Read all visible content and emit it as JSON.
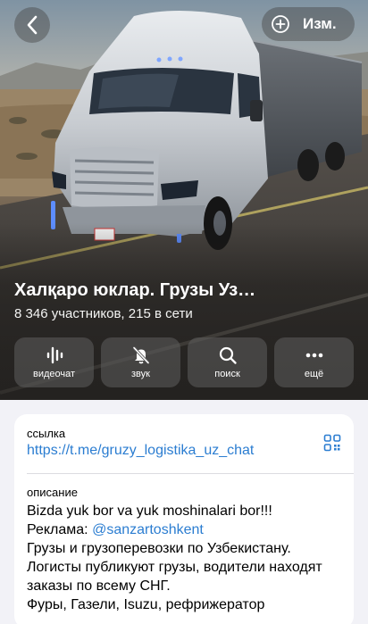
{
  "header": {
    "back_icon": "chevron-left-icon",
    "edit_icon": "add-circle-icon",
    "edit_label": "Изм."
  },
  "chat": {
    "title": "Халқаро юклар. Грузы Уз…",
    "subtitle": "8 346 участников, 215 в сети"
  },
  "actions": [
    {
      "icon": "voice-chat-icon",
      "label": "видеочат"
    },
    {
      "icon": "bell-muted-icon",
      "label": "звук"
    },
    {
      "icon": "search-icon",
      "label": "поиск"
    },
    {
      "icon": "more-icon",
      "label": "ещё"
    }
  ],
  "info": {
    "link_caption": "ссылка",
    "link_value": "https://t.me/gruzy_logistika_uz_chat",
    "qr_icon": "qr-code-icon",
    "description_caption": "описание",
    "description": {
      "line1": "Bizda yuk bor va yuk moshinalari bor!!!",
      "line2_prefix": "Реклама: ",
      "line2_mention": "@sanzartoshkent",
      "line3": "Грузы и грузоперевозки по Узбекистану.",
      "line4": "Логисты публикуют грузы, водители находят",
      "line5": "заказы по всему СНГ.",
      "line6": "Фуры, Газели, Isuzu, рефрижератор"
    }
  },
  "colors": {
    "accent": "#2b7dd1",
    "background": "#f2f2f7"
  }
}
